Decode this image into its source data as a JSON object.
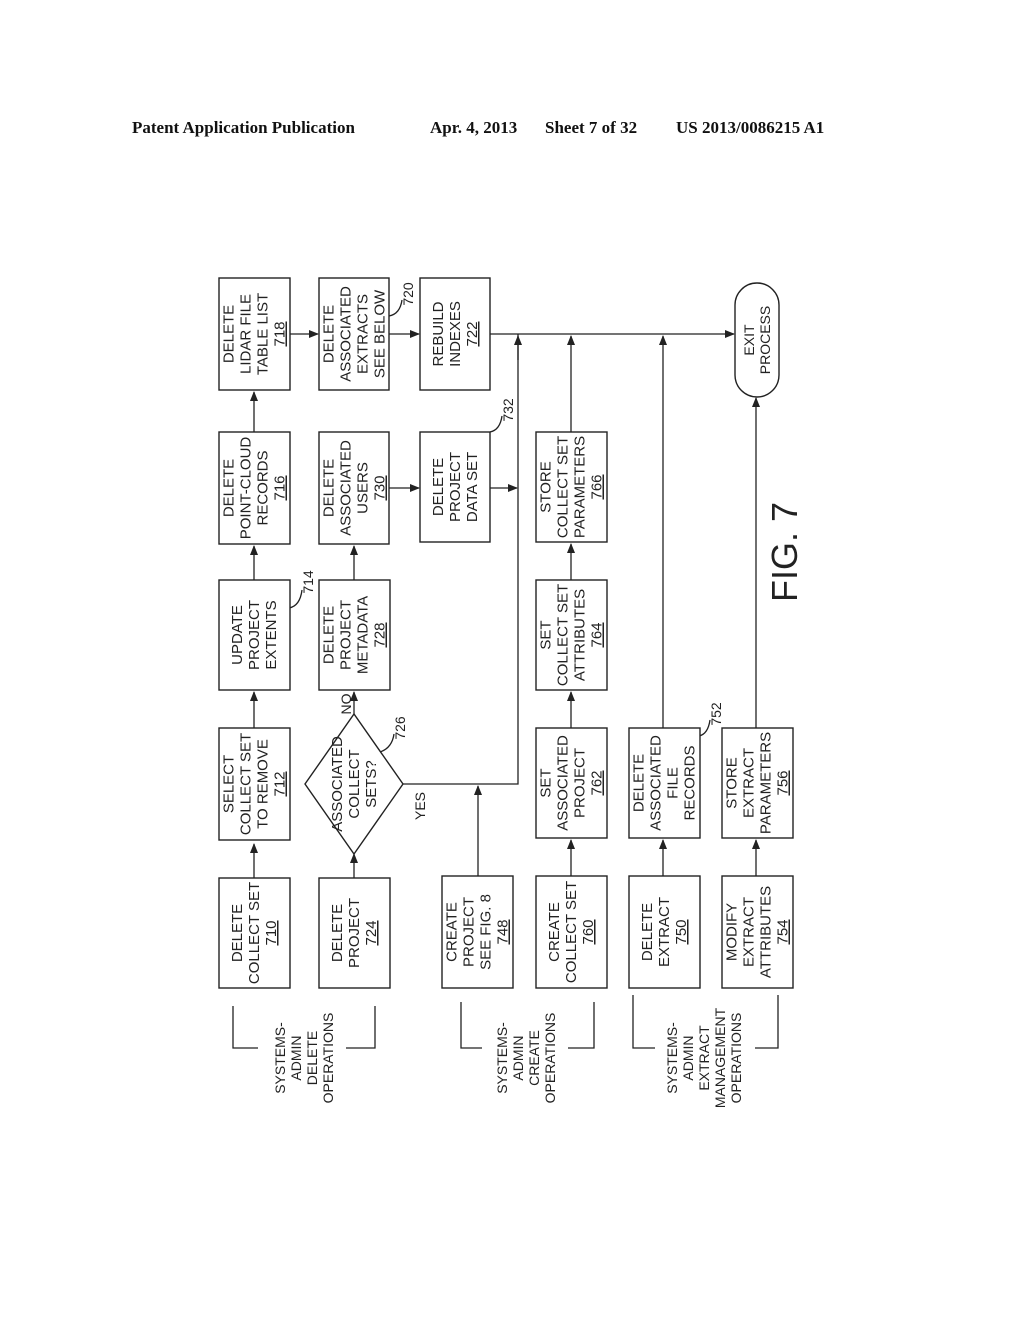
{
  "header": {
    "publication": "Patent Application Publication",
    "date": "Apr. 4, 2013",
    "sheet": "Sheet 7 of 32",
    "number": "US 2013/0086215 A1"
  },
  "figure": {
    "label": "FIG. 7"
  },
  "groups": {
    "delete_ops": [
      "SYSTEMS-",
      "ADMIN",
      "DELETE",
      "OPERATIONS"
    ],
    "create_ops": [
      "SYSTEMS-",
      "ADMIN",
      "CREATE",
      "OPERATIONS"
    ],
    "extract_ops": [
      "SYSTEMS-",
      "ADMIN",
      "EXTRACT",
      "MANAGEMENT",
      "OPERATIONS"
    ]
  },
  "nodes": {
    "n710": {
      "lines": [
        "DELETE",
        "COLLECT SET"
      ],
      "ref": "710"
    },
    "n712": {
      "lines": [
        "SELECT",
        "COLLECT SET",
        "TO REMOVE"
      ],
      "ref": "712"
    },
    "n714": {
      "lines": [
        "UPDATE",
        "PROJECT",
        "EXTENTS"
      ],
      "ref": "",
      "callout": "714"
    },
    "n716": {
      "lines": [
        "DELETE",
        "POINT-CLOUD",
        "RECORDS"
      ],
      "ref": "716"
    },
    "n718": {
      "lines": [
        "DELETE",
        "LIDAR FILE",
        "TABLE LIST"
      ],
      "ref": "718"
    },
    "n720": {
      "lines": [
        "DELETE",
        "ASSOCIATED",
        "EXTRACTS",
        "SEE BELOW"
      ],
      "ref": "",
      "callout": "720"
    },
    "n722": {
      "lines": [
        "REBUILD",
        "INDEXES"
      ],
      "ref": "722"
    },
    "n724": {
      "lines": [
        "DELETE",
        "PROJECT"
      ],
      "ref": "724"
    },
    "n726": {
      "lines": [
        "ASSOCIATED",
        "COLLECT",
        "SETS?"
      ],
      "ref": "",
      "callout": "726",
      "yes": "YES",
      "no": "NO"
    },
    "n728": {
      "lines": [
        "DELETE",
        "PROJECT",
        "METADATA"
      ],
      "ref": "728"
    },
    "n730": {
      "lines": [
        "DELETE",
        "ASSOCIATED",
        "USERS"
      ],
      "ref": "730"
    },
    "n732": {
      "lines": [
        "DELETE",
        "PROJECT",
        "DATA SET"
      ],
      "ref": "",
      "callout": "732"
    },
    "n748": {
      "lines": [
        "CREATE",
        "PROJECT",
        "SEE FIG. 8"
      ],
      "ref": "748"
    },
    "n760": {
      "lines": [
        "CREATE",
        "COLLECT SET"
      ],
      "ref": "760"
    },
    "n762": {
      "lines": [
        "SET",
        "ASSOCIATED",
        "PROJECT"
      ],
      "ref": "762"
    },
    "n764": {
      "lines": [
        "SET",
        "COLLECT SET",
        "ATTRIBUTES"
      ],
      "ref": "764"
    },
    "n766": {
      "lines": [
        "STORE",
        "COLLECT SET",
        "PARAMETERS"
      ],
      "ref": "766"
    },
    "n750": {
      "lines": [
        "DELETE",
        "EXTRACT"
      ],
      "ref": "750"
    },
    "n752": {
      "lines": [
        "DELETE",
        "ASSOCIATED",
        "FILE",
        "RECORDS"
      ],
      "ref": "",
      "callout": "752"
    },
    "n754": {
      "lines": [
        "MODIFY",
        "EXTRACT",
        "ATTRIBUTES"
      ],
      "ref": "754"
    },
    "n756": {
      "lines": [
        "STORE",
        "EXTRACT",
        "PARAMETERS"
      ],
      "ref": "756"
    },
    "exit": {
      "lines": [
        "EXIT",
        "PROCESS"
      ],
      "ref": ""
    }
  }
}
